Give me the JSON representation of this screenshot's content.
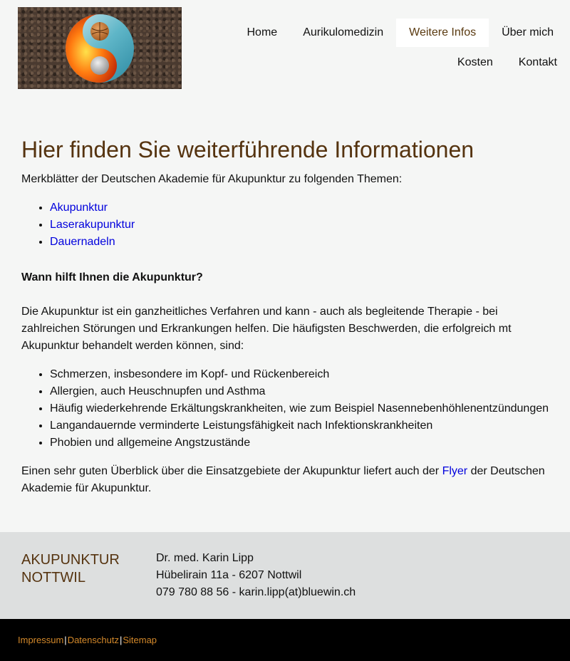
{
  "nav": {
    "items": [
      {
        "label": "Home"
      },
      {
        "label": "Aurikulomedizin"
      },
      {
        "label": "Weitere Infos"
      },
      {
        "label": "Über mich"
      },
      {
        "label": "Kosten"
      },
      {
        "label": "Kontakt"
      }
    ],
    "active": "Weitere Infos"
  },
  "main": {
    "title": "Hier finden Sie weiterführende Informationen",
    "intro": "Merkblätter der Deutschen Akademie für Akupunktur zu folgenden Themen:",
    "links": [
      "Akupunktur",
      "Laserakupunktur",
      "Dauernadeln"
    ],
    "question": "Wann hilft Ihnen die Akupunktur?",
    "paragraph": "Die Akupunktur ist ein ganzheitliches Verfahren und kann - auch als begleitende Therapie - bei zahlreichen Störungen und Erkrankungen helfen. Die häufigsten Beschwerden, die erfolgreich mt Akupunktur behandelt werden können, sind:",
    "conditions": [
      "Schmerzen, insbesondere im Kopf- und Rückenbereich",
      "Allergien, auch Heuschnupfen und Asthma",
      "Häufig wiederkehrende Erkältungskrankheiten, wie zum Beispiel Nasennebenhöhlenentzündungen",
      "Langandauernde verminderte Leistungsfähigkeit nach Infektionskrankheiten",
      "Phobien und allgemeine Angstzustände"
    ],
    "outro_before": "Einen sehr guten Überblick über die Einsatzgebiete der Akupunktur liefert auch der ",
    "outro_link": "Flyer",
    "outro_after": " der Deutschen Akademie für Akupunktur."
  },
  "footer": {
    "brand_line1": "AKUPUNKTUR",
    "brand_line2": "NOTTWIL",
    "name": "Dr. med. Karin Lipp",
    "address": "Hübelirain 11a - 6207 Nottwil",
    "phone_email": "079 780 88 56 - karin.lipp(at)bluewin.ch"
  },
  "bottom": {
    "links": [
      "Impressum",
      "Datenschutz",
      "Sitemap"
    ],
    "separator": "|"
  },
  "colors": {
    "accent": "#55330f",
    "link": "#0000dd",
    "footer_link": "#d4892a",
    "footer_bg": "#dddfdf"
  }
}
